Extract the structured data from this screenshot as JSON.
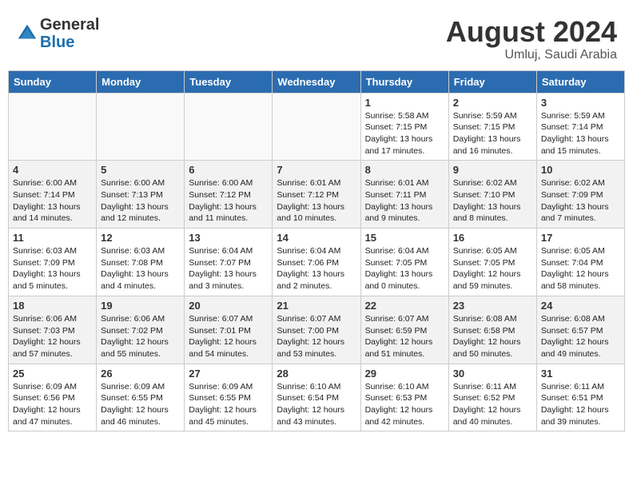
{
  "header": {
    "logo_general": "General",
    "logo_blue": "Blue",
    "main_title": "August 2024",
    "sub_title": "Umluj, Saudi Arabia"
  },
  "days_of_week": [
    "Sunday",
    "Monday",
    "Tuesday",
    "Wednesday",
    "Thursday",
    "Friday",
    "Saturday"
  ],
  "weeks": [
    {
      "shade": false,
      "days": [
        {
          "num": "",
          "info": ""
        },
        {
          "num": "",
          "info": ""
        },
        {
          "num": "",
          "info": ""
        },
        {
          "num": "",
          "info": ""
        },
        {
          "num": "1",
          "info": "Sunrise: 5:58 AM\nSunset: 7:15 PM\nDaylight: 13 hours\nand 17 minutes."
        },
        {
          "num": "2",
          "info": "Sunrise: 5:59 AM\nSunset: 7:15 PM\nDaylight: 13 hours\nand 16 minutes."
        },
        {
          "num": "3",
          "info": "Sunrise: 5:59 AM\nSunset: 7:14 PM\nDaylight: 13 hours\nand 15 minutes."
        }
      ]
    },
    {
      "shade": true,
      "days": [
        {
          "num": "4",
          "info": "Sunrise: 6:00 AM\nSunset: 7:14 PM\nDaylight: 13 hours\nand 14 minutes."
        },
        {
          "num": "5",
          "info": "Sunrise: 6:00 AM\nSunset: 7:13 PM\nDaylight: 13 hours\nand 12 minutes."
        },
        {
          "num": "6",
          "info": "Sunrise: 6:00 AM\nSunset: 7:12 PM\nDaylight: 13 hours\nand 11 minutes."
        },
        {
          "num": "7",
          "info": "Sunrise: 6:01 AM\nSunset: 7:12 PM\nDaylight: 13 hours\nand 10 minutes."
        },
        {
          "num": "8",
          "info": "Sunrise: 6:01 AM\nSunset: 7:11 PM\nDaylight: 13 hours\nand 9 minutes."
        },
        {
          "num": "9",
          "info": "Sunrise: 6:02 AM\nSunset: 7:10 PM\nDaylight: 13 hours\nand 8 minutes."
        },
        {
          "num": "10",
          "info": "Sunrise: 6:02 AM\nSunset: 7:09 PM\nDaylight: 13 hours\nand 7 minutes."
        }
      ]
    },
    {
      "shade": false,
      "days": [
        {
          "num": "11",
          "info": "Sunrise: 6:03 AM\nSunset: 7:09 PM\nDaylight: 13 hours\nand 5 minutes."
        },
        {
          "num": "12",
          "info": "Sunrise: 6:03 AM\nSunset: 7:08 PM\nDaylight: 13 hours\nand 4 minutes."
        },
        {
          "num": "13",
          "info": "Sunrise: 6:04 AM\nSunset: 7:07 PM\nDaylight: 13 hours\nand 3 minutes."
        },
        {
          "num": "14",
          "info": "Sunrise: 6:04 AM\nSunset: 7:06 PM\nDaylight: 13 hours\nand 2 minutes."
        },
        {
          "num": "15",
          "info": "Sunrise: 6:04 AM\nSunset: 7:05 PM\nDaylight: 13 hours\nand 0 minutes."
        },
        {
          "num": "16",
          "info": "Sunrise: 6:05 AM\nSunset: 7:05 PM\nDaylight: 12 hours\nand 59 minutes."
        },
        {
          "num": "17",
          "info": "Sunrise: 6:05 AM\nSunset: 7:04 PM\nDaylight: 12 hours\nand 58 minutes."
        }
      ]
    },
    {
      "shade": true,
      "days": [
        {
          "num": "18",
          "info": "Sunrise: 6:06 AM\nSunset: 7:03 PM\nDaylight: 12 hours\nand 57 minutes."
        },
        {
          "num": "19",
          "info": "Sunrise: 6:06 AM\nSunset: 7:02 PM\nDaylight: 12 hours\nand 55 minutes."
        },
        {
          "num": "20",
          "info": "Sunrise: 6:07 AM\nSunset: 7:01 PM\nDaylight: 12 hours\nand 54 minutes."
        },
        {
          "num": "21",
          "info": "Sunrise: 6:07 AM\nSunset: 7:00 PM\nDaylight: 12 hours\nand 53 minutes."
        },
        {
          "num": "22",
          "info": "Sunrise: 6:07 AM\nSunset: 6:59 PM\nDaylight: 12 hours\nand 51 minutes."
        },
        {
          "num": "23",
          "info": "Sunrise: 6:08 AM\nSunset: 6:58 PM\nDaylight: 12 hours\nand 50 minutes."
        },
        {
          "num": "24",
          "info": "Sunrise: 6:08 AM\nSunset: 6:57 PM\nDaylight: 12 hours\nand 49 minutes."
        }
      ]
    },
    {
      "shade": false,
      "days": [
        {
          "num": "25",
          "info": "Sunrise: 6:09 AM\nSunset: 6:56 PM\nDaylight: 12 hours\nand 47 minutes."
        },
        {
          "num": "26",
          "info": "Sunrise: 6:09 AM\nSunset: 6:55 PM\nDaylight: 12 hours\nand 46 minutes."
        },
        {
          "num": "27",
          "info": "Sunrise: 6:09 AM\nSunset: 6:55 PM\nDaylight: 12 hours\nand 45 minutes."
        },
        {
          "num": "28",
          "info": "Sunrise: 6:10 AM\nSunset: 6:54 PM\nDaylight: 12 hours\nand 43 minutes."
        },
        {
          "num": "29",
          "info": "Sunrise: 6:10 AM\nSunset: 6:53 PM\nDaylight: 12 hours\nand 42 minutes."
        },
        {
          "num": "30",
          "info": "Sunrise: 6:11 AM\nSunset: 6:52 PM\nDaylight: 12 hours\nand 40 minutes."
        },
        {
          "num": "31",
          "info": "Sunrise: 6:11 AM\nSunset: 6:51 PM\nDaylight: 12 hours\nand 39 minutes."
        }
      ]
    }
  ]
}
